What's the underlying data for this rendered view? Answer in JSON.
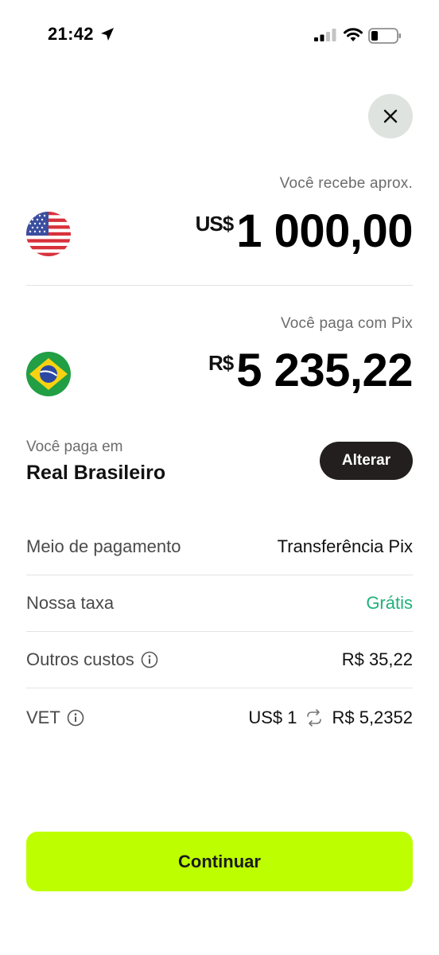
{
  "status_bar": {
    "time": "21:42"
  },
  "receive": {
    "caption": "Você recebe aprox.",
    "currency_symbol": "US$",
    "amount": "1 000,00",
    "flag": "us-flag-icon"
  },
  "pay": {
    "caption": "Você paga com Pix",
    "currency_symbol": "R$",
    "amount": "5 235,22",
    "flag": "brazil-flag-icon"
  },
  "pay_currency": {
    "label": "Você paga em",
    "name": "Real Brasileiro",
    "change_label": "Alterar"
  },
  "details": {
    "payment_method_label": "Meio de pagamento",
    "payment_method_value": "Transferência Pix",
    "fee_label": "Nossa taxa",
    "fee_value": "Grátis",
    "other_costs_label": "Outros custos",
    "other_costs_value": "R$ 35,22",
    "vet_label": "VET",
    "vet_from": "US$ 1",
    "vet_to": "R$ 5,2352"
  },
  "continue_label": "Continuar",
  "colors": {
    "accent": "#bdff00",
    "free": "#21b17a",
    "dark_button": "#231f1e"
  }
}
